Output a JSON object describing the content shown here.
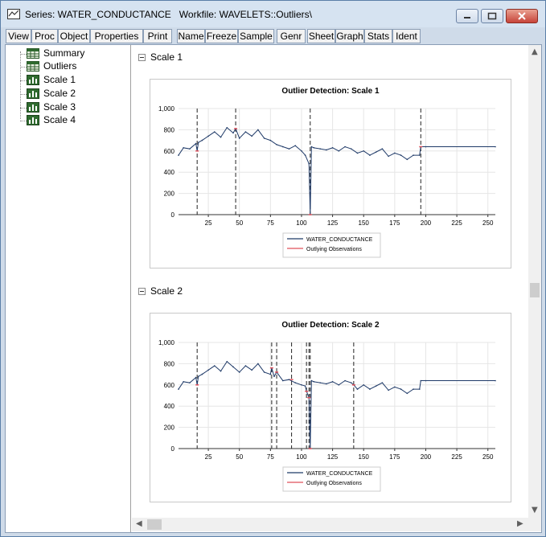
{
  "window": {
    "title": "Series: WATER_CONDUCTANCE   Workfile: WAVELETS::Outliers\\"
  },
  "toolbar": [
    {
      "label": "View"
    },
    {
      "label": "Proc"
    },
    {
      "label": "Object"
    },
    {
      "label": "Properties"
    },
    {
      "label": "Print"
    },
    {
      "label": "Name"
    },
    {
      "label": "Freeze"
    },
    {
      "label": "Sample"
    },
    {
      "label": "Genr"
    },
    {
      "label": "Sheet"
    },
    {
      "label": "Graph"
    },
    {
      "label": "Stats"
    },
    {
      "label": "Ident"
    }
  ],
  "tree": {
    "items": [
      {
        "label": "Summary",
        "icon": "table-icon"
      },
      {
        "label": "Outliers",
        "icon": "table-icon"
      },
      {
        "label": "Scale 1",
        "icon": "graph-icon"
      },
      {
        "label": "Scale 2",
        "icon": "graph-icon"
      },
      {
        "label": "Scale 3",
        "icon": "graph-icon"
      },
      {
        "label": "Scale 4",
        "icon": "graph-icon"
      }
    ]
  },
  "sections": [
    {
      "heading": "Scale 1"
    },
    {
      "heading": "Scale 2"
    }
  ],
  "colors": {
    "series": "#1f3a68",
    "outlier": "#e0505a",
    "grid": "#e6e6e6"
  },
  "chart_data": [
    {
      "type": "line",
      "title": "Outlier Detection: Scale 1",
      "x_ticks": [
        25,
        50,
        75,
        100,
        125,
        150,
        175,
        200,
        225,
        250
      ],
      "y_ticks": [
        "0",
        "200",
        "400",
        "600",
        "800",
        "1,000"
      ],
      "xlim": [
        1,
        256
      ],
      "ylim": [
        0,
        1000
      ],
      "legend": [
        "WATER_CONDUCTANCE",
        "Outlying Observations"
      ],
      "legend_position": "bottom-center",
      "series": [
        {
          "name": "WATER_CONDUCTANCE",
          "x": [
            1,
            5,
            10,
            15,
            16,
            17,
            20,
            25,
            30,
            35,
            40,
            45,
            47,
            50,
            55,
            60,
            65,
            70,
            75,
            80,
            85,
            90,
            95,
            100,
            103,
            106,
            107,
            108,
            110,
            115,
            120,
            125,
            130,
            135,
            140,
            145,
            150,
            155,
            160,
            165,
            170,
            175,
            180,
            185,
            190,
            195,
            196,
            200,
            256
          ],
          "y": [
            560,
            630,
            620,
            670,
            600,
            680,
            700,
            740,
            780,
            730,
            820,
            770,
            810,
            720,
            780,
            740,
            800,
            720,
            700,
            660,
            640,
            620,
            650,
            600,
            560,
            480,
            0,
            640,
            630,
            620,
            610,
            630,
            600,
            640,
            620,
            580,
            600,
            560,
            590,
            620,
            550,
            580,
            560,
            520,
            560,
            560,
            640,
            640,
            640
          ]
        },
        {
          "name": "Outlying Observations",
          "x": [
            16,
            47,
            107,
            196
          ],
          "y": [
            600,
            810,
            0,
            640
          ]
        }
      ],
      "outlier_lines_x": [
        16,
        47,
        107,
        196
      ]
    },
    {
      "type": "line",
      "title": "Outlier Detection: Scale 2",
      "x_ticks": [
        25,
        50,
        75,
        100,
        125,
        150,
        175,
        200,
        225,
        250
      ],
      "y_ticks": [
        "0",
        "200",
        "400",
        "600",
        "800",
        "1,000"
      ],
      "xlim": [
        1,
        256
      ],
      "ylim": [
        0,
        1000
      ],
      "legend": [
        "WATER_CONDUCTANCE",
        "Outlying Observations"
      ],
      "legend_position": "bottom-center",
      "series": [
        {
          "name": "WATER_CONDUCTANCE",
          "x": [
            1,
            5,
            10,
            15,
            16,
            17,
            20,
            25,
            30,
            35,
            40,
            45,
            50,
            55,
            60,
            65,
            70,
            75,
            76,
            78,
            80,
            85,
            90,
            95,
            100,
            103,
            104,
            106,
            107,
            108,
            110,
            115,
            120,
            125,
            130,
            135,
            140,
            142,
            145,
            150,
            155,
            160,
            165,
            170,
            175,
            180,
            185,
            190,
            195,
            196,
            200,
            256
          ],
          "y": [
            560,
            630,
            620,
            670,
            600,
            680,
            700,
            740,
            780,
            730,
            820,
            770,
            720,
            780,
            740,
            800,
            720,
            700,
            760,
            680,
            720,
            640,
            650,
            620,
            600,
            590,
            540,
            480,
            0,
            640,
            630,
            620,
            610,
            630,
            600,
            640,
            620,
            600,
            560,
            600,
            560,
            590,
            620,
            550,
            580,
            560,
            520,
            560,
            560,
            640,
            640,
            640
          ]
        },
        {
          "name": "Outlying Observations",
          "x": [
            16,
            76,
            80,
            92,
            104,
            106,
            107,
            142
          ],
          "y": [
            600,
            760,
            720,
            650,
            540,
            480,
            0,
            600
          ]
        }
      ],
      "outlier_lines_x": [
        16,
        76,
        80,
        92,
        104,
        106,
        107,
        142
      ]
    }
  ]
}
